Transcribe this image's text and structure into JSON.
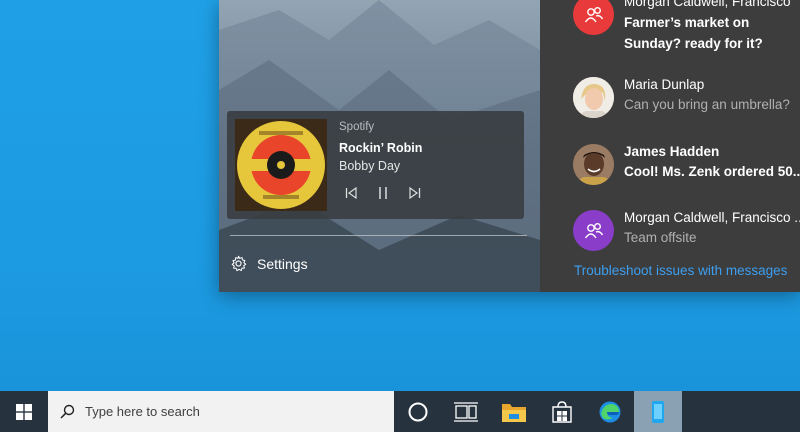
{
  "media": {
    "app": "Spotify",
    "track": "Rockin’ Robin",
    "artist": "Bobby Day"
  },
  "settings": {
    "label": "Settings"
  },
  "messages": [
    {
      "name": "Morgan Caldwell, Francisco",
      "text": "Farmer’s market on Sunday? ready for it?",
      "avatar": "group-icon",
      "avatar_color": "#e83a3a"
    },
    {
      "name": "Maria Dunlap",
      "text": "Can you bring an umbrella?",
      "avatar": "photo"
    },
    {
      "name": "James Hadden",
      "text": "Cool! Ms. Zenk ordered 50...",
      "avatar": "photo"
    },
    {
      "name": "Morgan Caldwell, Francisco ...",
      "text": "Team offsite",
      "avatar": "group-icon",
      "avatar_color": "#8a3dc8"
    }
  ],
  "troubleshoot": {
    "label": "Troubleshoot issues with messages"
  },
  "taskbar": {
    "search_placeholder": "Type here to search",
    "icons": [
      "windows-start-icon",
      "cortana-icon",
      "task-view-icon",
      "file-explorer-icon",
      "store-icon",
      "edge-icon",
      "your-phone-icon"
    ]
  },
  "colors": {
    "accent": "#3d9ef0",
    "taskbar": "#26333f",
    "panel": "#3d3d3d"
  }
}
